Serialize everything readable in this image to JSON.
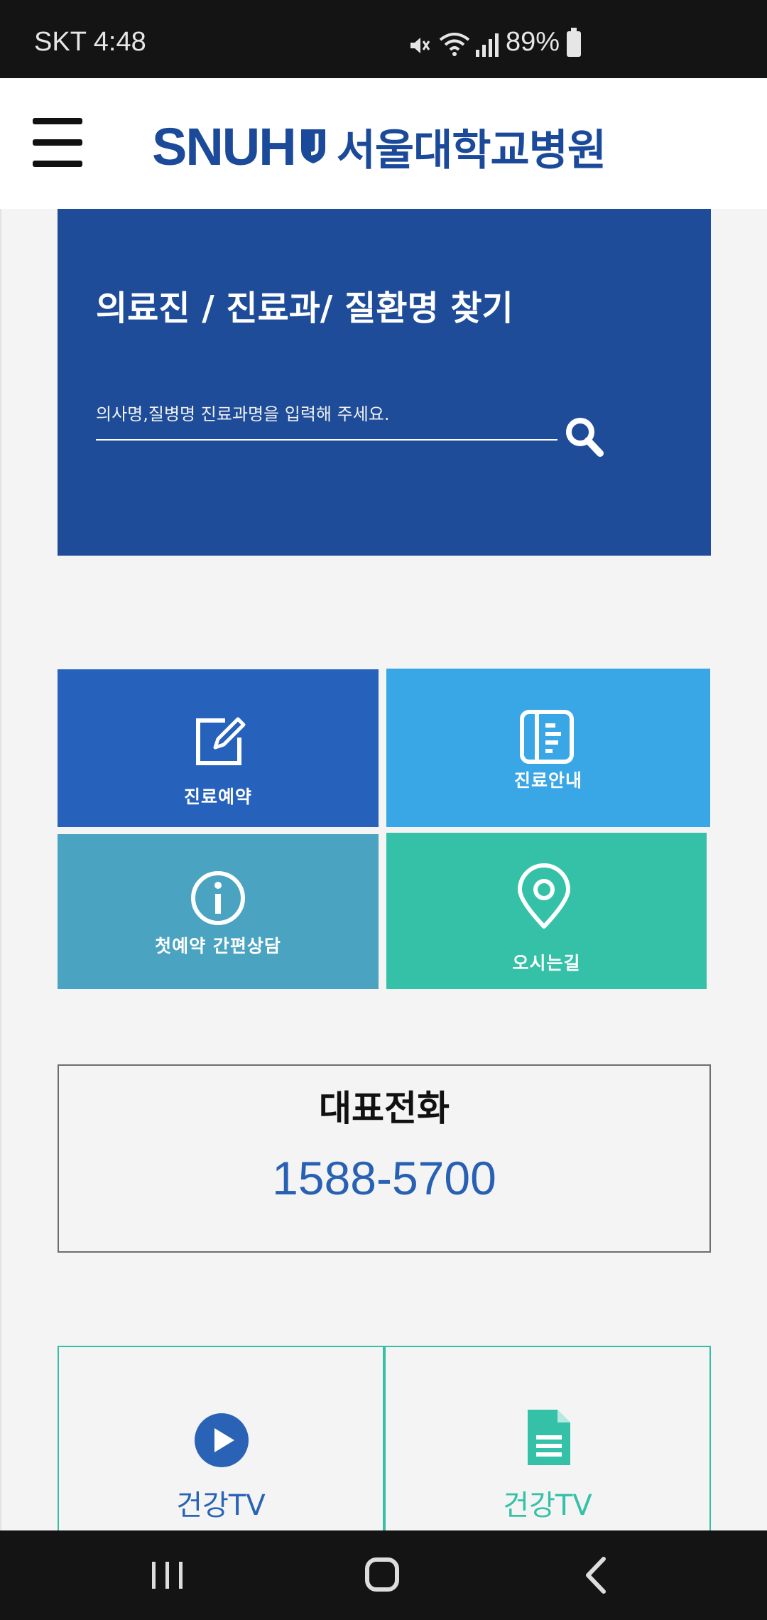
{
  "status_bar": {
    "carrier_time": "SKT 4:48",
    "battery": "89%"
  },
  "header": {
    "logo_en": "SNUH",
    "logo_ko": "서울대학교병원"
  },
  "search": {
    "title": "의료진 / 진료과/ 질환명 찾기",
    "placeholder": "의사명,질병명 진료과명을 입력해 주세요."
  },
  "tiles": [
    {
      "label": "진료예약",
      "icon": "edit-icon",
      "color": "#2661bc"
    },
    {
      "label": "진료안내",
      "icon": "document-list-icon",
      "color": "#39a6e6"
    },
    {
      "label": "첫예약 간편상담",
      "icon": "info-icon",
      "color": "#4aa3c1"
    },
    {
      "label": "오시는길",
      "icon": "location-pin-icon",
      "color": "#35c1a8"
    }
  ],
  "phone": {
    "title": "대표전화",
    "number": "1588-5700"
  },
  "health_tv": [
    {
      "label": "건강TV",
      "icon": "play-circle-icon",
      "color": "#2a63b6"
    },
    {
      "label": "건강TV",
      "icon": "document-icon",
      "color": "#35c1a8"
    }
  ],
  "nav": {
    "recent": "recent-apps-icon",
    "home": "home-icon",
    "back": "back-icon"
  }
}
